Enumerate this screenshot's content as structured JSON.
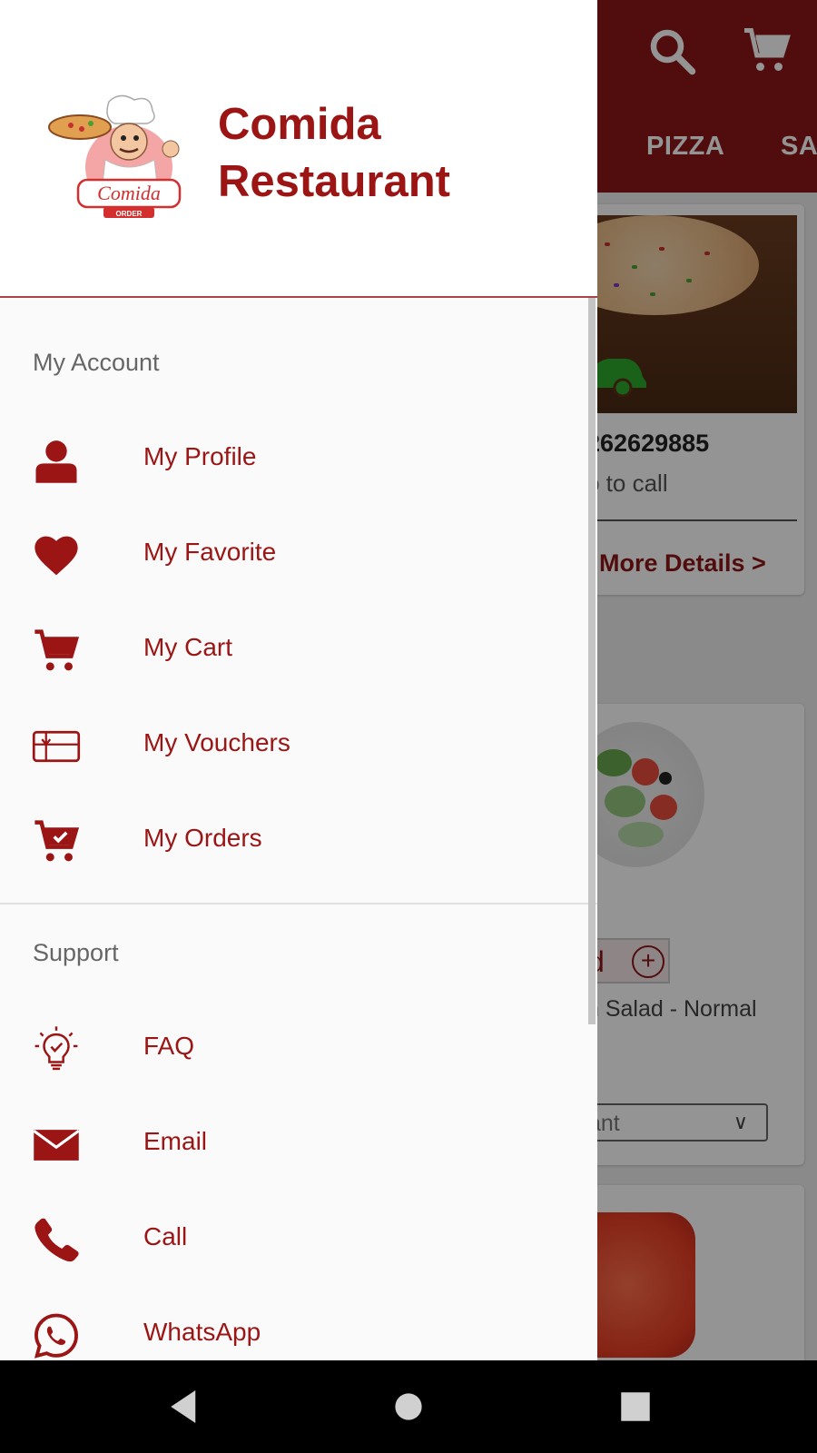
{
  "background": {
    "categories": [
      "PIZZA",
      "SA"
    ],
    "restaurant_phone": "262629885",
    "tap_hint": "p to call",
    "more_details": "More Details >",
    "add_partial": "d",
    "salad_name": "n Salad - Normal",
    "select_value": "ant",
    "icons": [
      "search-icon",
      "cart-icon"
    ]
  },
  "drawer": {
    "brand_line1": "Comida",
    "brand_line2": "Restaurant",
    "logo_text": "Comida",
    "logo_subtext": "ORDER",
    "account_section": "My Account",
    "account_items": [
      {
        "label": "My Profile",
        "icon": "profile-icon"
      },
      {
        "label": "My Favorite",
        "icon": "heart-icon"
      },
      {
        "label": "My Cart",
        "icon": "cart-icon"
      },
      {
        "label": "My Vouchers",
        "icon": "voucher-icon"
      },
      {
        "label": "My Orders",
        "icon": "orders-icon"
      }
    ],
    "support_section": "Support",
    "support_items": [
      {
        "label": "FAQ",
        "icon": "lightbulb-icon"
      },
      {
        "label": "Email",
        "icon": "email-icon"
      },
      {
        "label": "Call",
        "icon": "phone-icon"
      },
      {
        "label": "WhatsApp",
        "icon": "whatsapp-icon"
      }
    ]
  },
  "navbar": {
    "buttons": [
      "back-icon",
      "home-icon",
      "recents-icon"
    ]
  },
  "colors": {
    "brand": "#9c1515",
    "topbar": "#8c1717",
    "navbar": "#000000"
  }
}
